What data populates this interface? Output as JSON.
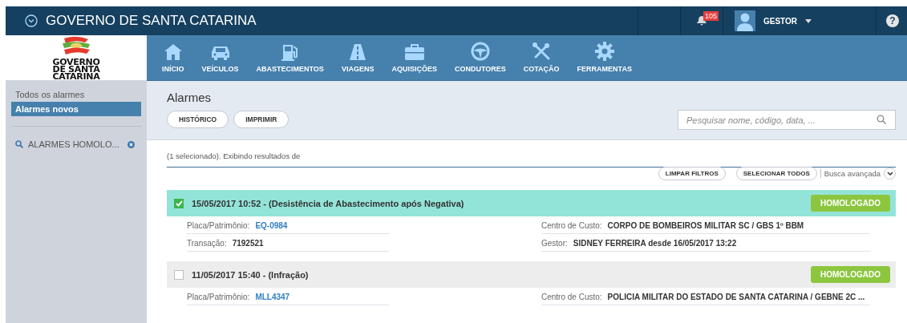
{
  "header": {
    "title": "GOVERNO DE SANTA CATARINA",
    "notifications": "105",
    "user": "GESTOR",
    "help": "?"
  },
  "logo": {
    "lines": [
      "GOVERNO",
      "DE SANTA",
      "CATARINA"
    ]
  },
  "nav": [
    {
      "label": "INÍCIO"
    },
    {
      "label": "VEÍCULOS"
    },
    {
      "label": "ABASTECIMENTOS"
    },
    {
      "label": "VIAGENS"
    },
    {
      "label": "AQUISIÇÕES"
    },
    {
      "label": "CONDUTORES"
    },
    {
      "label": "COTAÇÃO"
    },
    {
      "label": "FERRAMENTAS"
    }
  ],
  "sidebar": {
    "items": [
      {
        "label": "Todos os alarmes",
        "selected": false
      },
      {
        "label": "Alarmes novos",
        "selected": true
      }
    ],
    "filter": "ALARMES HOMOLO..."
  },
  "page": {
    "title": "Alarmes",
    "buttons": [
      "HISTÓRICO",
      "IMPRIMIR"
    ],
    "search": {
      "placeholder": "Pesquisar nome, código, data, ..."
    }
  },
  "results": {
    "summary": "(1 selecionado). Exibindo resultados de",
    "actions": [
      "LIMPAR FILTROS",
      "SELECIONAR TODOS"
    ],
    "advanced": "Busca avançada"
  },
  "alarms": [
    {
      "checked": true,
      "title": "15/05/2017 10:52 - (Desistência de Abastecimento após Negativa)",
      "status": "HOMOLOGADO",
      "left": [
        {
          "label": "Placa/Patrimônio:",
          "value": "EQ-0984",
          "link": true
        },
        {
          "label": "Transação:",
          "value": "7192521",
          "link": false
        }
      ],
      "right": [
        {
          "label": "Centro de Custo:",
          "value": "CORPO DE BOMBEIROS MILITAR SC / GBS 1º BBM"
        },
        {
          "label": "Gestor:",
          "value": "SIDNEY FERREIRA desde 16/05/2017 13:22"
        }
      ]
    },
    {
      "checked": false,
      "title": "11/05/2017 15:40 - (Infração)",
      "status": "HOMOLOGADO",
      "left": [
        {
          "label": "Placa/Patrimônio:",
          "value": "MLL4347",
          "link": true
        }
      ],
      "right": [
        {
          "label": "Centro de Custo:",
          "value": "POLICIA MILITAR DO ESTADO DE SANTA CATARINA / GEBNE 2C ..."
        }
      ]
    }
  ]
}
